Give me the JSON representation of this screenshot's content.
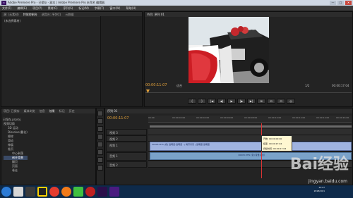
{
  "window": {
    "title": "Adobe Premiere Pro - 已保存 - 副本 | Adobe Premiere Pro 未命名 编辑器",
    "controls": [
      "—",
      "□",
      "✕"
    ]
  },
  "menu": [
    "文件(F)",
    "编辑(E)",
    "项目(P)",
    "素材(C)",
    "序列(S)",
    "标记(M)",
    "字幕(T)",
    "窗口(W)",
    "帮助(H)"
  ],
  "source": {
    "tabs": [
      "源: (无素材)",
      "特效控制台",
      "调音台: 序列01",
      "元数据"
    ],
    "placeholder": "(未选择素材)"
  },
  "program": {
    "tab": "节目: 序列 01",
    "timecode": "00:00:11:07",
    "fit": "适合",
    "quality": "1/2",
    "duration": "00:00:17:04"
  },
  "transport": [
    "{",
    "}",
    "|◀",
    "◀|",
    "▶",
    "|▶",
    "▶|",
    "⊞",
    "⊟",
    "⊡",
    "◎"
  ],
  "project": {
    "tabs": [
      "项目: 已保存",
      "媒体浏览",
      "信息",
      "效果",
      "标记",
      "历史"
    ],
    "title": "已保存.prproj",
    "tree": [
      "视频切换",
      "3D 运动",
      "Dissolve(叠化)",
      "擦除",
      "滑动",
      "伸展",
      "卷页",
      "中心剥落",
      "剥开背景",
      "翻页",
      "页面",
      "卷走"
    ]
  },
  "timeline": {
    "tab": "序列 01",
    "timecode": "00:00:11:07",
    "ticks": [
      "00:00",
      "00:00:02:00",
      "00:00:04:00",
      "00:00:06:00",
      "00:00:08:00",
      "00:00:10:00",
      "00:00:12:00",
      "00:00:14:00",
      "00:00:16:00"
    ],
    "tracks": [
      "视频 3",
      "视频 2",
      "视频 1",
      "音频 1",
      "音频 2"
    ],
    "clips": [
      {
        "track": "视频 1",
        "label": "00005.MTS [视] 透明度:透明度 - | 剥开背景 | 透明度:透明度"
      },
      {
        "track": "音频 1",
        "label": "00005.MTS [音] 音量:级别"
      }
    ],
    "tooltip": [
      "开始: 00:00:00:00",
      "结束: 00:00:17:04",
      "持续时间: 00:00:17:04"
    ]
  },
  "taskbar": {
    "icons": [
      "start-icon",
      "media-icon",
      "video-icon",
      "qq-icon",
      "chrome-icon",
      "firefox-icon",
      "player-icon",
      "record-icon",
      "premiere-icon",
      "premiere2-icon"
    ],
    "time": "15:27",
    "date": "2018/10/1"
  },
  "watermark": {
    "text": "Bai经验",
    "sub": "jingyan.baidu.com"
  },
  "colors": {
    "accent": "#e4a23a",
    "clip": "#9fb3e0",
    "panel": "#232323"
  }
}
